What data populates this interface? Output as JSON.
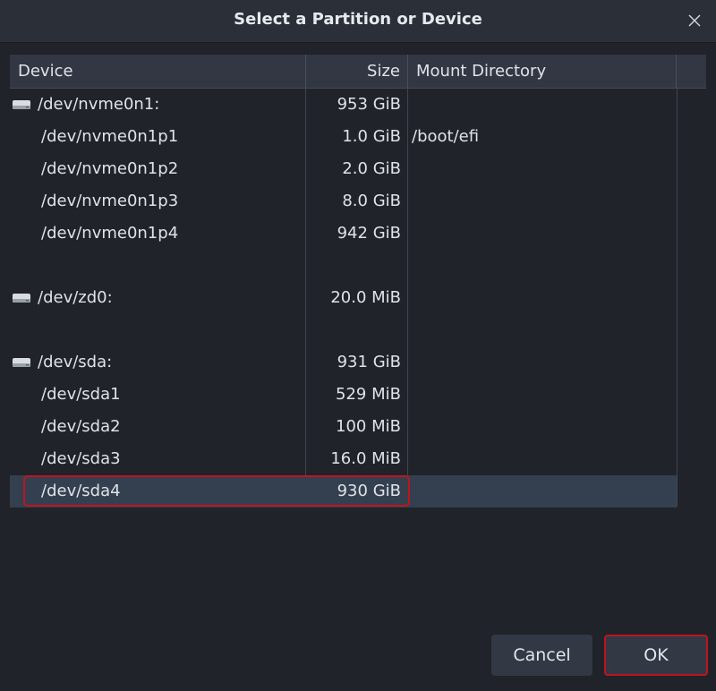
{
  "dialog": {
    "title": "Select a Partition or Device",
    "close_icon": "close-icon"
  },
  "table": {
    "columns": [
      "Device",
      "Size",
      "Mount Directory"
    ],
    "rows": [
      {
        "device": "/dev/nvme0n1:",
        "size": "953 GiB",
        "mount": "",
        "kind": "disk"
      },
      {
        "device": "/dev/nvme0n1p1",
        "size": "1.0 GiB",
        "mount": "/boot/efi",
        "kind": "partition"
      },
      {
        "device": "/dev/nvme0n1p2",
        "size": "2.0 GiB",
        "mount": "",
        "kind": "partition"
      },
      {
        "device": "/dev/nvme0n1p3",
        "size": "8.0 GiB",
        "mount": "",
        "kind": "partition"
      },
      {
        "device": "/dev/nvme0n1p4",
        "size": "942 GiB",
        "mount": "",
        "kind": "partition"
      },
      {
        "device": "/dev/zd0:",
        "size": "20.0 MiB",
        "mount": "",
        "kind": "disk"
      },
      {
        "device": "/dev/sda:",
        "size": "931 GiB",
        "mount": "",
        "kind": "disk"
      },
      {
        "device": "/dev/sda1",
        "size": "529 MiB",
        "mount": "",
        "kind": "partition"
      },
      {
        "device": "/dev/sda2",
        "size": "100 MiB",
        "mount": "",
        "kind": "partition"
      },
      {
        "device": "/dev/sda3",
        "size": "16.0 MiB",
        "mount": "",
        "kind": "partition"
      },
      {
        "device": "/dev/sda4",
        "size": "930 GiB",
        "mount": "",
        "kind": "partition",
        "selected": true
      }
    ]
  },
  "buttons": {
    "cancel": "Cancel",
    "ok": "OK"
  },
  "colors": {
    "background": "#202329",
    "selection": "#34404f",
    "highlight": "#c0141e"
  }
}
